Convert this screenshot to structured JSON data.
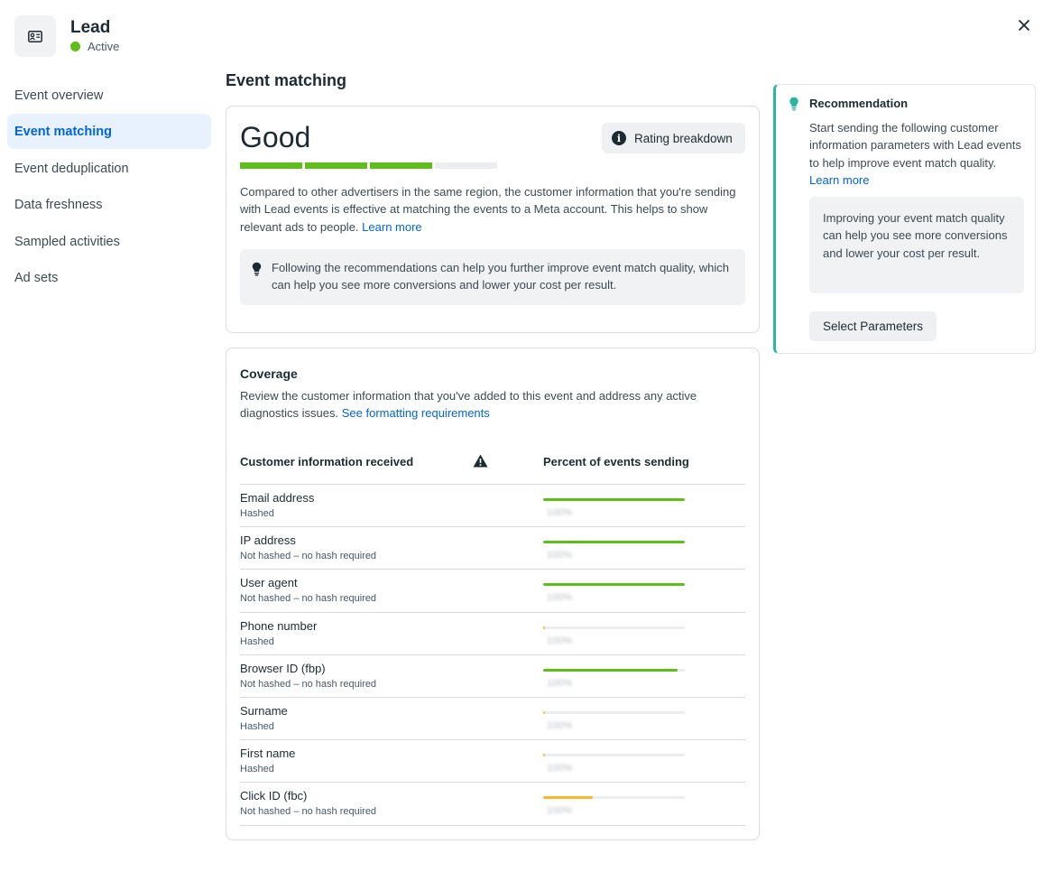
{
  "header": {
    "title": "Lead",
    "status": "Active",
    "event_icon": "id-card-icon",
    "close_icon": "close-icon"
  },
  "sidebar": {
    "items": [
      {
        "label": "Event overview",
        "active": false
      },
      {
        "label": "Event matching",
        "active": true
      },
      {
        "label": "Event deduplication",
        "active": false
      },
      {
        "label": "Data freshness",
        "active": false
      },
      {
        "label": "Sampled activities",
        "active": false
      },
      {
        "label": "Ad sets",
        "active": false
      }
    ]
  },
  "main": {
    "title": "Event matching",
    "quality": {
      "rating": "Good",
      "rating_button": "Rating breakdown",
      "score_segments_filled": 3,
      "score_segments_total": 4,
      "description": "Compared to other advertisers in the same region, the customer information that you're sending with Lead events is effective at matching the events to a Meta account. This helps to show relevant ads to people.",
      "learn_more": "Learn more",
      "tip": "Following the recommendations can help you further improve event match quality, which can help you see more conversions and lower your cost per result."
    },
    "coverage": {
      "title": "Coverage",
      "description": "Review the customer information that you've added to this event and address any active diagnostics issues.",
      "link": "See formatting requirements",
      "col_info": "Customer information received",
      "col_percent": "Percent of events sending",
      "rows": [
        {
          "name": "Email address",
          "status": "Hashed",
          "percent_label": "100%",
          "fill": 1.0,
          "color": "#5fbf1a"
        },
        {
          "name": "IP address",
          "status": "Not hashed – no hash required",
          "percent_label": "100%",
          "fill": 1.0,
          "color": "#5fbf1a"
        },
        {
          "name": "User agent",
          "status": "Not hashed – no hash required",
          "percent_label": "100%",
          "fill": 1.0,
          "color": "#5fbf1a"
        },
        {
          "name": "Phone number",
          "status": "Hashed",
          "percent_label": "100%",
          "fill": 0.01,
          "color": "#f7b928"
        },
        {
          "name": "Browser ID (fbp)",
          "status": "Not hashed – no hash required",
          "percent_label": "100%",
          "fill": 0.95,
          "color": "#5fbf1a"
        },
        {
          "name": "Surname",
          "status": "Hashed",
          "percent_label": "100%",
          "fill": 0.01,
          "color": "#f7b928"
        },
        {
          "name": "First name",
          "status": "Hashed",
          "percent_label": "100%",
          "fill": 0.01,
          "color": "#f7b928"
        },
        {
          "name": "Click ID (fbc)",
          "status": "Not hashed – no hash required",
          "percent_label": "100%",
          "fill": 0.35,
          "color": "#f7b928"
        }
      ]
    }
  },
  "recommendation": {
    "title": "Recommendation",
    "body": "Start sending the following customer information parameters with Lead events to help improve event match quality.",
    "learn_more": "Learn more",
    "note": "Improving your event match quality can help you see more conversions and lower your cost per result.",
    "button": "Select Parameters"
  },
  "colors": {
    "accent": "#0064e0",
    "good": "#5fbf1a",
    "warning": "#f7b928",
    "teal": "#2bb5a3"
  }
}
